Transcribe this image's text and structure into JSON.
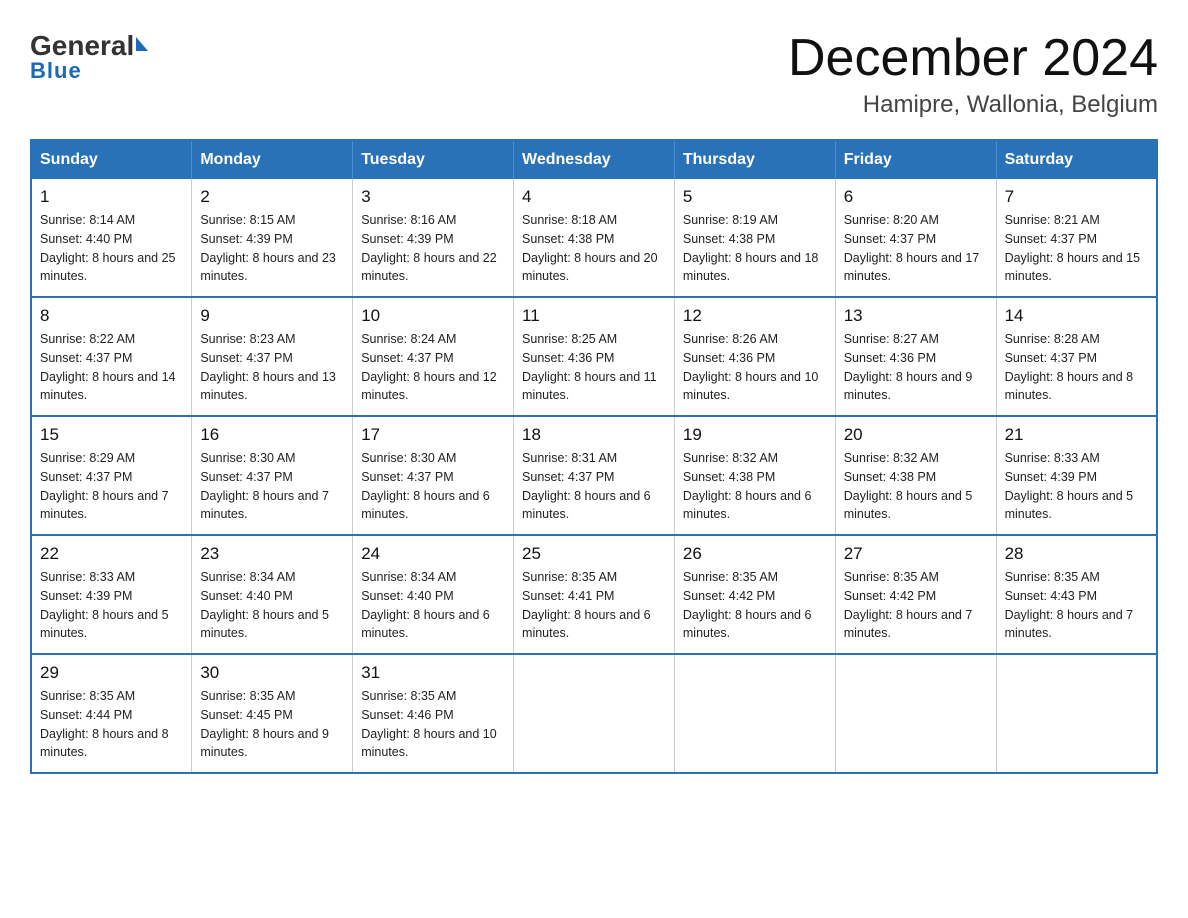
{
  "header": {
    "logo": {
      "general": "General",
      "triangle": "",
      "blue": "Blue"
    },
    "month_title": "December 2024",
    "location": "Hamipre, Wallonia, Belgium"
  },
  "days_of_week": [
    "Sunday",
    "Monday",
    "Tuesday",
    "Wednesday",
    "Thursday",
    "Friday",
    "Saturday"
  ],
  "weeks": [
    [
      {
        "day": "1",
        "sunrise": "8:14 AM",
        "sunset": "4:40 PM",
        "daylight": "8 hours and 25 minutes."
      },
      {
        "day": "2",
        "sunrise": "8:15 AM",
        "sunset": "4:39 PM",
        "daylight": "8 hours and 23 minutes."
      },
      {
        "day": "3",
        "sunrise": "8:16 AM",
        "sunset": "4:39 PM",
        "daylight": "8 hours and 22 minutes."
      },
      {
        "day": "4",
        "sunrise": "8:18 AM",
        "sunset": "4:38 PM",
        "daylight": "8 hours and 20 minutes."
      },
      {
        "day": "5",
        "sunrise": "8:19 AM",
        "sunset": "4:38 PM",
        "daylight": "8 hours and 18 minutes."
      },
      {
        "day": "6",
        "sunrise": "8:20 AM",
        "sunset": "4:37 PM",
        "daylight": "8 hours and 17 minutes."
      },
      {
        "day": "7",
        "sunrise": "8:21 AM",
        "sunset": "4:37 PM",
        "daylight": "8 hours and 15 minutes."
      }
    ],
    [
      {
        "day": "8",
        "sunrise": "8:22 AM",
        "sunset": "4:37 PM",
        "daylight": "8 hours and 14 minutes."
      },
      {
        "day": "9",
        "sunrise": "8:23 AM",
        "sunset": "4:37 PM",
        "daylight": "8 hours and 13 minutes."
      },
      {
        "day": "10",
        "sunrise": "8:24 AM",
        "sunset": "4:37 PM",
        "daylight": "8 hours and 12 minutes."
      },
      {
        "day": "11",
        "sunrise": "8:25 AM",
        "sunset": "4:36 PM",
        "daylight": "8 hours and 11 minutes."
      },
      {
        "day": "12",
        "sunrise": "8:26 AM",
        "sunset": "4:36 PM",
        "daylight": "8 hours and 10 minutes."
      },
      {
        "day": "13",
        "sunrise": "8:27 AM",
        "sunset": "4:36 PM",
        "daylight": "8 hours and 9 minutes."
      },
      {
        "day": "14",
        "sunrise": "8:28 AM",
        "sunset": "4:37 PM",
        "daylight": "8 hours and 8 minutes."
      }
    ],
    [
      {
        "day": "15",
        "sunrise": "8:29 AM",
        "sunset": "4:37 PM",
        "daylight": "8 hours and 7 minutes."
      },
      {
        "day": "16",
        "sunrise": "8:30 AM",
        "sunset": "4:37 PM",
        "daylight": "8 hours and 7 minutes."
      },
      {
        "day": "17",
        "sunrise": "8:30 AM",
        "sunset": "4:37 PM",
        "daylight": "8 hours and 6 minutes."
      },
      {
        "day": "18",
        "sunrise": "8:31 AM",
        "sunset": "4:37 PM",
        "daylight": "8 hours and 6 minutes."
      },
      {
        "day": "19",
        "sunrise": "8:32 AM",
        "sunset": "4:38 PM",
        "daylight": "8 hours and 6 minutes."
      },
      {
        "day": "20",
        "sunrise": "8:32 AM",
        "sunset": "4:38 PM",
        "daylight": "8 hours and 5 minutes."
      },
      {
        "day": "21",
        "sunrise": "8:33 AM",
        "sunset": "4:39 PM",
        "daylight": "8 hours and 5 minutes."
      }
    ],
    [
      {
        "day": "22",
        "sunrise": "8:33 AM",
        "sunset": "4:39 PM",
        "daylight": "8 hours and 5 minutes."
      },
      {
        "day": "23",
        "sunrise": "8:34 AM",
        "sunset": "4:40 PM",
        "daylight": "8 hours and 5 minutes."
      },
      {
        "day": "24",
        "sunrise": "8:34 AM",
        "sunset": "4:40 PM",
        "daylight": "8 hours and 6 minutes."
      },
      {
        "day": "25",
        "sunrise": "8:35 AM",
        "sunset": "4:41 PM",
        "daylight": "8 hours and 6 minutes."
      },
      {
        "day": "26",
        "sunrise": "8:35 AM",
        "sunset": "4:42 PM",
        "daylight": "8 hours and 6 minutes."
      },
      {
        "day": "27",
        "sunrise": "8:35 AM",
        "sunset": "4:42 PM",
        "daylight": "8 hours and 7 minutes."
      },
      {
        "day": "28",
        "sunrise": "8:35 AM",
        "sunset": "4:43 PM",
        "daylight": "8 hours and 7 minutes."
      }
    ],
    [
      {
        "day": "29",
        "sunrise": "8:35 AM",
        "sunset": "4:44 PM",
        "daylight": "8 hours and 8 minutes."
      },
      {
        "day": "30",
        "sunrise": "8:35 AM",
        "sunset": "4:45 PM",
        "daylight": "8 hours and 9 minutes."
      },
      {
        "day": "31",
        "sunrise": "8:35 AM",
        "sunset": "4:46 PM",
        "daylight": "8 hours and 10 minutes."
      },
      null,
      null,
      null,
      null
    ]
  ]
}
